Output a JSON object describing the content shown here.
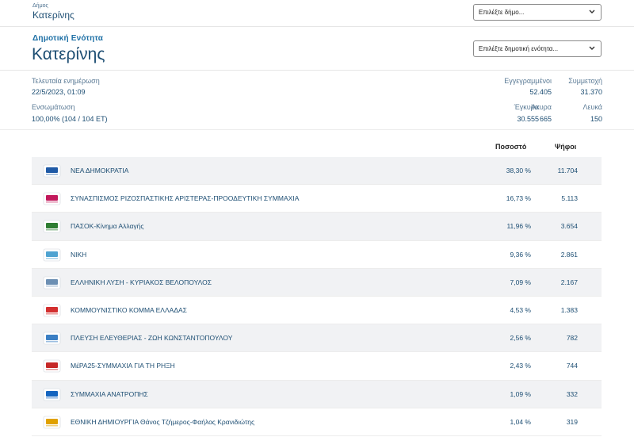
{
  "header": {
    "small_label": "Δήμος",
    "municipality": "Κατερίνης",
    "select_municipality": "Επιλέξτε δήμο..."
  },
  "unit": {
    "label": "Δημοτική Ενότητα",
    "name": "Κατερίνης",
    "select_unit": "Επιλέξτε δημοτική ενότητα..."
  },
  "info": {
    "last_update_label": "Τελευταία ενημέρωση",
    "last_update_value": "22/5/2023, 01:09",
    "integration_label": "Ενσωμάτωση",
    "integration_value": "100,00% (104 / 104 ΕΤ)",
    "registered_label": "Εγγεγραμμένοι",
    "registered_value": "52.405",
    "turnout_label": "Συμμετοχή",
    "turnout_value": "31.370",
    "valid_label": "Έγκυρα",
    "valid_value": "30.555",
    "invalid_label": "Άκυρα",
    "invalid_value": "665",
    "blank_label": "Λευκά",
    "blank_value": "150"
  },
  "table": {
    "col_percent": "Ποσοστό",
    "col_votes": "Ψήφοι",
    "rows": [
      {
        "name": "ΝΕΑ ΔΗΜΟΚΡΑΤΙΑ",
        "percent": "38,30 %",
        "votes": "11.704",
        "logo": "nd-logo-icon",
        "color": "#1f5aa6"
      },
      {
        "name": "ΣΥΝΑΣΠΙΣΜΟΣ ΡΙΖΟΣΠΑΣΤΙΚΗΣ ΑΡΙΣΤΕΡΑΣ-ΠΡΟΟΔΕΥΤΙΚΗ ΣΥΜΜΑΧΙΑ",
        "percent": "16,73 %",
        "votes": "5.113",
        "logo": "syriza-logo-icon",
        "color": "#c2185b"
      },
      {
        "name": "ΠΑΣΟΚ-Κίνημα Αλλαγής",
        "percent": "11,96 %",
        "votes": "3.654",
        "logo": "pasok-logo-icon",
        "color": "#2e7d32"
      },
      {
        "name": "ΝΙΚΗ",
        "percent": "9,36 %",
        "votes": "2.861",
        "logo": "niki-logo-icon",
        "color": "#4fa3d1"
      },
      {
        "name": "ΕΛΛΗΝΙΚΗ ΛΥΣΗ - ΚΥΡΙΑΚΟΣ ΒΕΛΟΠΟΥΛΟΣ",
        "percent": "7,09 %",
        "votes": "2.167",
        "logo": "elliniki-lysi-logo-icon",
        "color": "#6c8fb3"
      },
      {
        "name": "ΚΟΜΜΟΥΝΙΣΤΙΚΟ ΚΟΜΜΑ ΕΛΛΑΔΑΣ",
        "percent": "4,53 %",
        "votes": "1.383",
        "logo": "kke-logo-icon",
        "color": "#d32f2f"
      },
      {
        "name": "ΠΛΕΥΣΗ ΕΛΕΥΘΕΡΙΑΣ - ΖΩΗ ΚΩΝΣΤΑΝΤΟΠΟΥΛΟΥ",
        "percent": "2,56 %",
        "votes": "782",
        "logo": "plefsi-logo-icon",
        "color": "#3b7fc4"
      },
      {
        "name": "ΜέΡΑ25-ΣΥΜΜΑΧΙΑ ΓΙΑ ΤΗ ΡΗΞΗ",
        "percent": "2,43 %",
        "votes": "744",
        "logo": "mera25-logo-icon",
        "color": "#c62828"
      },
      {
        "name": "ΣΥΜΜΑΧΙΑ ΑΝΑΤΡΟΠΗΣ",
        "percent": "1,09 %",
        "votes": "332",
        "logo": "anatropi-logo-icon",
        "color": "#1565c0"
      },
      {
        "name": "ΕΘΝΙΚΗ ΔΗΜΙΟΥΡΓΙΑ Θάνος Τζήμερος-Φαήλος Κρανιδιώτης",
        "percent": "1,04 %",
        "votes": "319",
        "logo": "ethniki-dimiourgia-logo-icon",
        "color": "#e0a100"
      }
    ]
  }
}
